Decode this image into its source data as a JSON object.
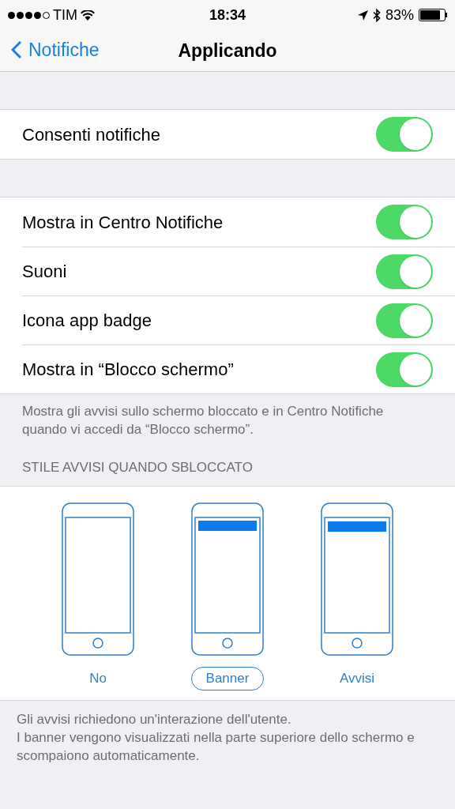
{
  "status_bar": {
    "carrier": "TIM",
    "time": "18:34",
    "battery": "83%"
  },
  "nav": {
    "back": "Notifiche",
    "title": "Applicando"
  },
  "groups": [
    {
      "rows": [
        {
          "label": "Consenti notifiche",
          "on": true
        }
      ]
    },
    {
      "rows": [
        {
          "label": "Mostra in Centro Notifiche",
          "on": true
        },
        {
          "label": "Suoni",
          "on": true
        },
        {
          "label": "Icona app badge",
          "on": true
        },
        {
          "label": "Mostra in “Blocco schermo”",
          "on": true
        }
      ],
      "footer": "Mostra gli avvisi sullo schermo bloccato e in Centro Notifiche quando vi accedi da “Blocco schermo”."
    }
  ],
  "alert_style": {
    "header": "STILE AVVISI QUANDO SBLOCCATO",
    "options": [
      {
        "kind": "none",
        "label": "No",
        "selected": false
      },
      {
        "kind": "banner",
        "label": "Banner",
        "selected": true
      },
      {
        "kind": "alert",
        "label": "Avvisi",
        "selected": false
      }
    ],
    "footer": [
      "Gli avvisi richiedono un'interazione dell'utente.",
      "I banner vengono visualizzati nella parte superiore dello schermo e scompaiono automaticamente."
    ]
  }
}
